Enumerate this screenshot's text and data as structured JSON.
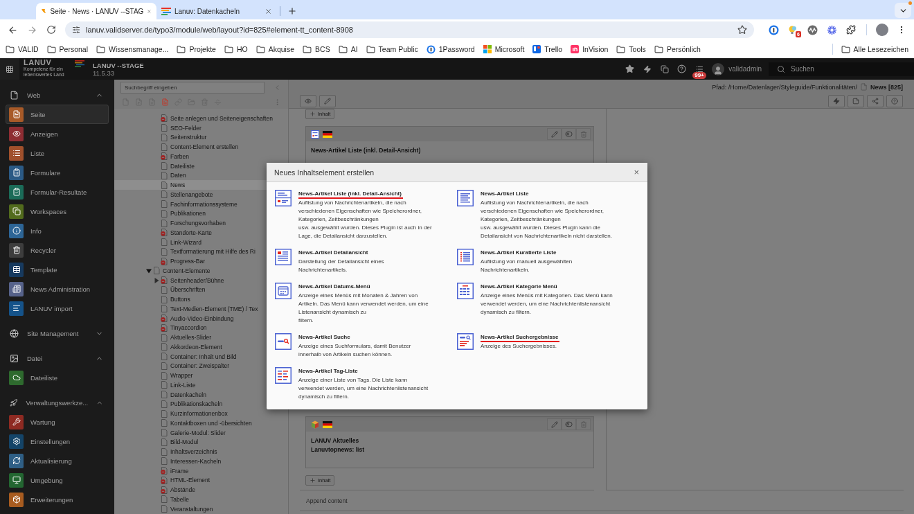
{
  "browser": {
    "tabs": [
      {
        "title": "Seite · News · LANUV --STAG",
        "kind": "typo3",
        "selected": true
      },
      {
        "title": "Lanuv: Datenkacheln",
        "kind": "lanuv",
        "selected": false
      }
    ],
    "url": "lanuv.validserver.de/typo3/module/web/layout?id=825#element-tt_content-8908",
    "extension_badge": "6",
    "bookmarks": [
      {
        "label": "VALID",
        "kind": "folder"
      },
      {
        "label": "Personal",
        "kind": "folder"
      },
      {
        "label": "Wissensmanage...",
        "kind": "folder"
      },
      {
        "label": "Projekte",
        "kind": "folder"
      },
      {
        "label": "HO",
        "kind": "folder"
      },
      {
        "label": "Akquise",
        "kind": "folder"
      },
      {
        "label": "BCS",
        "kind": "folder"
      },
      {
        "label": "AI",
        "kind": "folder"
      },
      {
        "label": "Team Public",
        "kind": "folder"
      },
      {
        "label": "1Password",
        "kind": "password"
      },
      {
        "label": "Microsoft",
        "kind": "microsoft"
      },
      {
        "label": "Trello",
        "kind": "trello"
      },
      {
        "label": "InVision",
        "kind": "invision"
      },
      {
        "label": "Tools",
        "kind": "folder"
      },
      {
        "label": "Persönlich",
        "kind": "folder"
      }
    ],
    "all_bookmarks": "Alle Lesezeichen"
  },
  "topbar": {
    "logo": "LANUV",
    "logo_tagline": "Kompetenz für ein lebenswertes Land",
    "site_name": "LANUV --STAGE",
    "version": "11.5.33",
    "notification_badge": "99+",
    "username": "validadmin",
    "search": {
      "placeholder": "Suchen"
    }
  },
  "module_menu": [
    {
      "label": "Web",
      "expanded": true,
      "items": [
        {
          "label": "Seite",
          "color": "#a85a28",
          "selected": true
        },
        {
          "label": "Anzeigen",
          "color": "#8e2d33",
          "selected": false
        },
        {
          "label": "Liste",
          "color": "#a0502c",
          "selected": false
        },
        {
          "label": "Formulare",
          "color": "#2b5a85",
          "selected": false
        },
        {
          "label": "Formular-Resultate",
          "color": "#1b6b58",
          "selected": false
        },
        {
          "label": "Workspaces",
          "color": "#526b1d",
          "selected": false
        },
        {
          "label": "Info",
          "color": "#2d6596",
          "selected": false
        },
        {
          "label": "Recycler",
          "color": "#3d3d3d",
          "selected": false
        },
        {
          "label": "Template",
          "color": "#173a5f",
          "selected": false
        },
        {
          "label": "News Administration",
          "color": "#56628a",
          "selected": false
        },
        {
          "label": "LANUV import",
          "color": "#15538a",
          "selected": false
        }
      ]
    },
    {
      "label": "Site Management",
      "expanded": false
    },
    {
      "label": "Datei",
      "expanded": true,
      "items": [
        {
          "label": "Dateiliste",
          "color": "#2e6a2e",
          "selected": false
        }
      ]
    },
    {
      "label": "Verwaltungswerkze...",
      "expanded": true,
      "items": [
        {
          "label": "Wartung",
          "color": "#8e2a22",
          "selected": false
        },
        {
          "label": "Einstellungen",
          "color": "#144468",
          "selected": false
        },
        {
          "label": "Aktualisierung",
          "color": "#2f5f85",
          "selected": false
        },
        {
          "label": "Umgebung",
          "color": "#236631",
          "selected": false
        },
        {
          "label": "Erweiterungen",
          "color": "#a85c20",
          "selected": false
        }
      ]
    }
  ],
  "page_tree": {
    "search": {
      "placeholder": "Suchbegriff eingeben"
    },
    "nodes": [
      {
        "children": [
          {
            "label": "Seite anlegen und Seiteneigenschaften",
            "kind": "restricted",
            "selected": false
          },
          {
            "label": "SEO-Felder",
            "kind": "page",
            "selected": false
          },
          {
            "label": "Seitenstruktur",
            "kind": "page",
            "selected": false
          },
          {
            "label": "Content-Element erstellen",
            "kind": "page",
            "selected": false
          },
          {
            "label": "Farben",
            "kind": "restricted",
            "selected": false
          },
          {
            "label": "Dateiliste",
            "kind": "page",
            "selected": false
          },
          {
            "label": "Daten",
            "kind": "page",
            "selected": false
          },
          {
            "label": "News",
            "kind": "page",
            "selected": true
          },
          {
            "label": "Stellenangebote",
            "kind": "page",
            "selected": false
          },
          {
            "label": "Fachinformationssysteme",
            "kind": "page",
            "selected": false
          },
          {
            "label": "Publikationen",
            "kind": "page",
            "selected": false
          },
          {
            "label": "Forschungsvorhaben",
            "kind": "page",
            "selected": false
          },
          {
            "label": "Standorte-Karte",
            "kind": "restricted",
            "selected": false
          },
          {
            "label": "Link-Wizard",
            "kind": "page",
            "selected": false
          },
          {
            "label": "Textformatierung mit Hilfe des Ri",
            "kind": "page",
            "selected": false
          },
          {
            "label": "Progress-Bar",
            "kind": "restricted",
            "selected": false
          }
        ]
      },
      {
        "label": "Content-Elemente",
        "kind": "page",
        "selected": false,
        "expanded": true,
        "children": [
          {
            "label": "Seitenheader/Bühne",
            "kind": "restricted",
            "selected": false,
            "expanded": false
          },
          {
            "label": "Überschriften",
            "kind": "page",
            "selected": false
          },
          {
            "label": "Buttons",
            "kind": "page",
            "selected": false
          },
          {
            "label": "Text-Medien-Element (TME) / Tex",
            "kind": "page",
            "selected": false
          },
          {
            "label": "Audio-Video-Einbindung",
            "kind": "restricted",
            "selected": false
          },
          {
            "label": "Tinyaccordion",
            "kind": "restricted",
            "selected": false
          },
          {
            "label": "Aktuelles-Slider",
            "kind": "page",
            "selected": false
          },
          {
            "label": "Akkordeon-Element",
            "kind": "page",
            "selected": false
          },
          {
            "label": "Container: Inhalt und Bild",
            "kind": "page",
            "selected": false
          },
          {
            "label": "Container: Zweispalter",
            "kind": "page",
            "selected": false
          },
          {
            "label": "Wrapper",
            "kind": "page",
            "selected": false
          },
          {
            "label": "Link-Liste",
            "kind": "page",
            "selected": false
          },
          {
            "label": "Datenkacheln",
            "kind": "page",
            "selected": false
          },
          {
            "label": "Publikationskacheln",
            "kind": "page",
            "selected": false
          },
          {
            "label": "Kurzinformationenbox",
            "kind": "page",
            "selected": false
          },
          {
            "label": "Kontaktboxen und -übersichten",
            "kind": "page",
            "selected": false
          },
          {
            "label": "Galerie-Modul: Slider",
            "kind": "page",
            "selected": false
          },
          {
            "label": "Bild-Modul",
            "kind": "page",
            "selected": false
          },
          {
            "label": "Inhaltsverzeichnis",
            "kind": "page",
            "selected": false
          },
          {
            "label": "Interessen-Kacheln",
            "kind": "page",
            "selected": false
          },
          {
            "label": "iFrame",
            "kind": "restricted",
            "selected": false
          },
          {
            "label": "HTML-Element",
            "kind": "restricted",
            "selected": false
          },
          {
            "label": "Abstände",
            "kind": "restricted",
            "selected": false
          },
          {
            "label": "Tabelle",
            "kind": "page",
            "selected": false
          },
          {
            "label": "Veranstaltungen",
            "kind": "page",
            "selected": false
          }
        ]
      }
    ]
  },
  "content": {
    "path": "Pfad: /Home/Datenlager/Styleguide/Funktionalitäten/",
    "page_title": "News [825]",
    "items": [
      {
        "kind": "add",
        "label": "Inhalt"
      },
      {
        "kind": "plugin",
        "lines": [
          "News-Artikel Liste (inkl. Detail-Ansicht)"
        ]
      },
      {
        "kind": "box",
        "lines": [
          "LANUV Aktuelles",
          "Lanuvtopnews: list"
        ]
      },
      {
        "kind": "add",
        "label": "Inhalt"
      }
    ],
    "append_label": "Append content"
  },
  "modal": {
    "title": "Neues Inhaltselement erstellen",
    "close": "×",
    "items": [
      {
        "kind": "listdetail",
        "title": "News-Artikel Liste (inkl. Detail-Ansicht)",
        "highlighted": true,
        "description": "Auflistung von Nachrichtenartikeln, die nach\nverschiedenen Eigenschaften wie Speicherordner,\nKategorien, Zeitbeschränkungen\nusw. ausgewählt wurden. Dieses Plugin ist auch in der\nLage, die Detailansicht darzustellen."
      },
      {
        "kind": "list",
        "title": "News-Artikel Liste",
        "highlighted": false,
        "description": "Auflistung von Nachrichtenartikeln, die nach\nverschiedenen Eigenschaften wie Speicherordner,\nKategorien, Zeitbeschränkungen\nusw. ausgewählt wurden. Dieses Plugin kann die\nDetailansicht von Nachrichtenartikeln nicht darstellen."
      },
      {
        "kind": "detail",
        "title": "News-Artikel Detailansicht",
        "highlighted": false,
        "description": "Darstellung der Detailansicht eines\nNachrichtenartikels."
      },
      {
        "kind": "curated",
        "title": "News-Artikel Kuratierte Liste",
        "highlighted": false,
        "description": "Auflistung von manuell ausgewählten\nNachrichtenartikeln."
      },
      {
        "kind": "datemenu",
        "title": "News-Artikel Datums-Menü",
        "highlighted": false,
        "description": "Anzeige eines Menüs mit Monaten & Jahren von\nArtikeln. Das Menü kann verwendet werden, um eine\nListenansicht dynamisch zu\nfiltern."
      },
      {
        "kind": "categorymenu",
        "title": "News-Artikel Kategorie Menü",
        "highlighted": false,
        "description": "Anzeige eines Menüs mit Kategorien. Das Menü kann\nverwendet werden, um eine Nachrichtenlistenansicht\ndynamisch zu filtern."
      },
      {
        "kind": "search",
        "title": "News-Artikel Suche",
        "highlighted": false,
        "description": "Anzeige eines Suchformulars, damit Benutzer\ninnerhalb von Artikeln suchen können."
      },
      {
        "kind": "results",
        "title": "News-Artikel Suchergebnisse",
        "highlighted": true,
        "description": "Anzeige des Suchergebnisses."
      },
      {
        "kind": "tags",
        "title": "News-Artikel Tag-Liste",
        "highlighted": false,
        "description": "Anzeige einer Liste von Tags. Die Liste kann\nverwendet werden, um eine Nachrichtenlistenansicht\ndynamisch zu filtern."
      }
    ]
  }
}
